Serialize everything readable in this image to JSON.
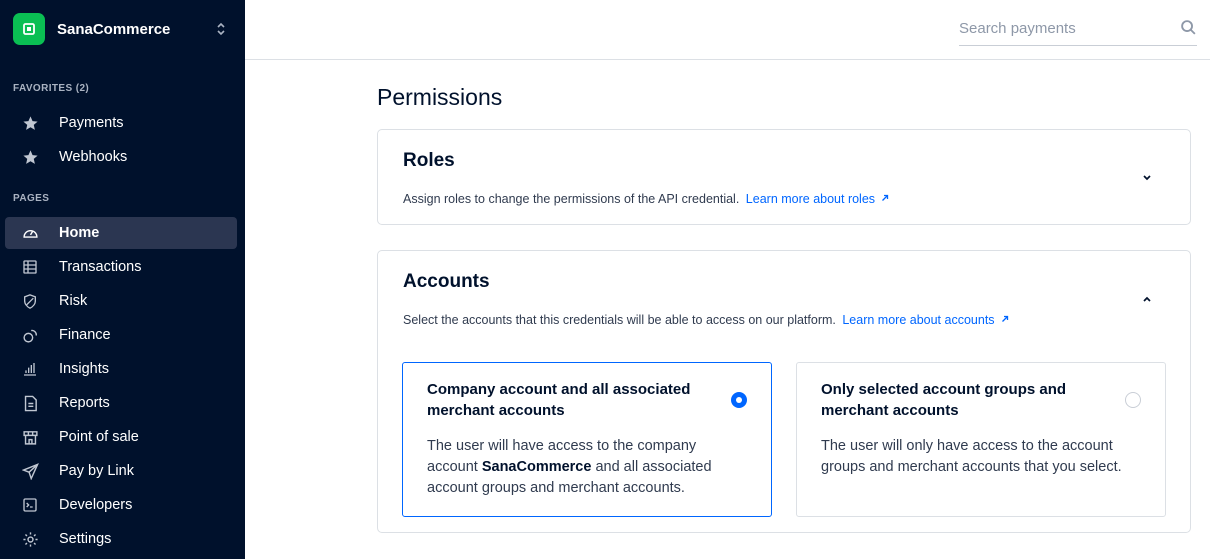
{
  "brand": {
    "name": "SanaCommerce",
    "logo_color": "#0abf53"
  },
  "sidebar": {
    "favorites_label": "FAVORITES (2)",
    "favorites": [
      {
        "label": "Payments",
        "icon": "star-icon"
      },
      {
        "label": "Webhooks",
        "icon": "star-icon"
      }
    ],
    "pages_label": "PAGES",
    "pages": [
      {
        "label": "Home",
        "icon": "home-dashboard-icon",
        "active": true
      },
      {
        "label": "Transactions",
        "icon": "table-icon"
      },
      {
        "label": "Risk",
        "icon": "shield-icon"
      },
      {
        "label": "Finance",
        "icon": "coins-icon"
      },
      {
        "label": "Insights",
        "icon": "bar-chart-icon"
      },
      {
        "label": "Reports",
        "icon": "document-icon"
      },
      {
        "label": "Point of sale",
        "icon": "store-icon"
      },
      {
        "label": "Pay by Link",
        "icon": "paper-plane-icon"
      },
      {
        "label": "Developers",
        "icon": "terminal-icon"
      },
      {
        "label": "Settings",
        "icon": "gear-icon"
      }
    ]
  },
  "search": {
    "placeholder": "Search payments",
    "value": ""
  },
  "page": {
    "title": "Permissions"
  },
  "roles": {
    "title": "Roles",
    "description": "Assign roles to change the permissions of the API credential.",
    "link": "Learn more about roles",
    "expanded": false
  },
  "accounts": {
    "title": "Accounts",
    "description": "Select the accounts that this credentials will be able to access on our platform.",
    "link": "Learn more about accounts",
    "expanded": true,
    "options": [
      {
        "title": "Company account and all associated merchant accounts",
        "desc_before": "The user will have access to the company account ",
        "desc_bold": "SanaCommerce",
        "desc_after": " and all associated account groups and merchant accounts.",
        "selected": true
      },
      {
        "title": "Only selected account groups and merchant accounts",
        "desc": "The user will only have access to the account groups and merchant accounts that you select.",
        "selected": false
      }
    ]
  },
  "colors": {
    "sidebar_bg": "#00112c",
    "active_bg": "#2b3651",
    "accent": "#0066ff"
  }
}
